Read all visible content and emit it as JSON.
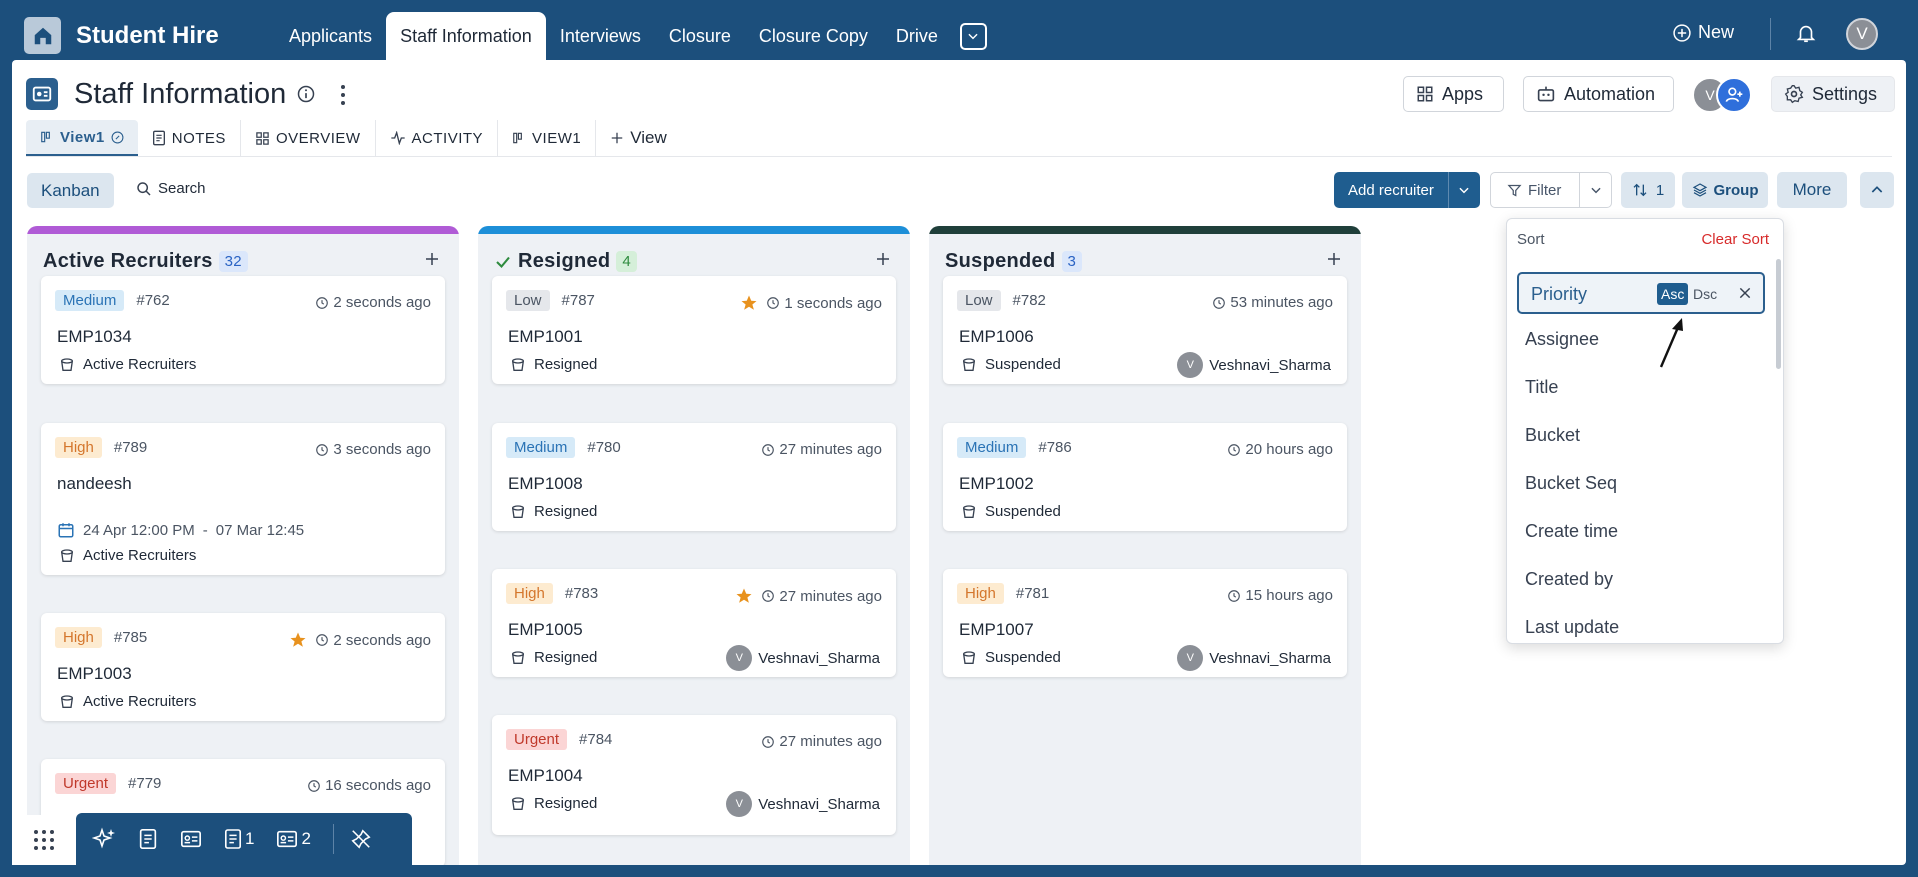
{
  "app": {
    "brand": "Student Hire",
    "nav_tabs": [
      "Applicants",
      "Staff Information",
      "Interviews",
      "Closure",
      "Closure Copy",
      "Drive"
    ],
    "active_tab": "Staff Information",
    "new_label": "New",
    "user_initial": "V"
  },
  "page": {
    "title": "Staff Information",
    "apps_label": "Apps",
    "automation_label": "Automation",
    "settings_label": "Settings",
    "member_initial": "V"
  },
  "view_tabs": [
    {
      "label": "View1",
      "active": true
    },
    {
      "label": "NOTES"
    },
    {
      "label": "OVERVIEW"
    },
    {
      "label": "ACTIVITY"
    },
    {
      "label": "VIEW1"
    },
    {
      "label": "View"
    }
  ],
  "toolbar": {
    "kanban_label": "Kanban",
    "search_label": "Search",
    "add_label": "Add recruiter",
    "filter_label": "Filter",
    "sort_count": "1",
    "group_label": "Group",
    "more_label": "More"
  },
  "columns": [
    {
      "title": "Active Recruiters",
      "count": "32",
      "bar_color": "#b05bd6",
      "count_bg": "#dbe7fb",
      "count_color": "#2a63c4",
      "cards": [
        {
          "priority": "Medium",
          "num": "#762",
          "time": "2 seconds ago",
          "title": "EMP1034",
          "bucket": "Active Recruiters"
        },
        {
          "priority": "High",
          "num": "#789",
          "time": "3 seconds ago",
          "title": "nandeesh",
          "date_start": "24 Apr 12:00 PM",
          "date_sep": "-",
          "date_end": "07 Mar 12:45",
          "bucket": "Active Recruiters"
        },
        {
          "priority": "High",
          "num": "#785",
          "time": "2 seconds ago",
          "starred": true,
          "title": "EMP1003",
          "bucket": "Active Recruiters"
        },
        {
          "priority": "Urgent",
          "num": "#779",
          "time": "16 seconds ago",
          "title": "",
          "bucket": ""
        }
      ]
    },
    {
      "title": "Resigned",
      "count": "4",
      "bar_color": "#1d8fd8",
      "count_bg": "#d5efd9",
      "count_color": "#2e8b3e",
      "cards": [
        {
          "priority": "Low",
          "num": "#787",
          "time": "1 seconds ago",
          "starred": true,
          "title": "EMP1001",
          "bucket": "Resigned"
        },
        {
          "priority": "Medium",
          "num": "#780",
          "time": "27 minutes ago",
          "title": "EMP1008",
          "bucket": "Resigned"
        },
        {
          "priority": "High",
          "num": "#783",
          "time": "27 minutes ago",
          "starred": true,
          "title": "EMP1005",
          "bucket": "Resigned",
          "assignee": "Veshnavi_Sharma",
          "assignee_initial": "V"
        },
        {
          "priority": "Urgent",
          "num": "#784",
          "time": "27 minutes ago",
          "title": "EMP1004",
          "bucket": "Resigned",
          "assignee": "Veshnavi_Sharma",
          "assignee_initial": "V"
        }
      ]
    },
    {
      "title": "Suspended",
      "count": "3",
      "bar_color": "#1f3f3a",
      "count_bg": "#dbe7fb",
      "count_color": "#2a63c4",
      "cards": [
        {
          "priority": "Low",
          "num": "#782",
          "time": "53 minutes ago",
          "title": "EMP1006",
          "bucket": "Suspended",
          "assignee": "Veshnavi_Sharma",
          "assignee_initial": "V"
        },
        {
          "priority": "Medium",
          "num": "#786",
          "time": "20 hours ago",
          "title": "EMP1002",
          "bucket": "Suspended"
        },
        {
          "priority": "High",
          "num": "#781",
          "time": "15 hours ago",
          "title": "EMP1007",
          "bucket": "Suspended",
          "assignee": "Veshnavi_Sharma",
          "assignee_initial": "V"
        }
      ]
    }
  ],
  "sort_menu": {
    "header": "Sort",
    "clear_label": "Clear Sort",
    "active_field": "Priority",
    "asc_label": "Asc",
    "dsc_label": "Dsc",
    "options": [
      "Assignee",
      "Title",
      "Bucket",
      "Bucket Seq",
      "Create time",
      "Created by",
      "Last update"
    ]
  },
  "dock": {
    "notes_count": "1",
    "cards_count": "2"
  }
}
